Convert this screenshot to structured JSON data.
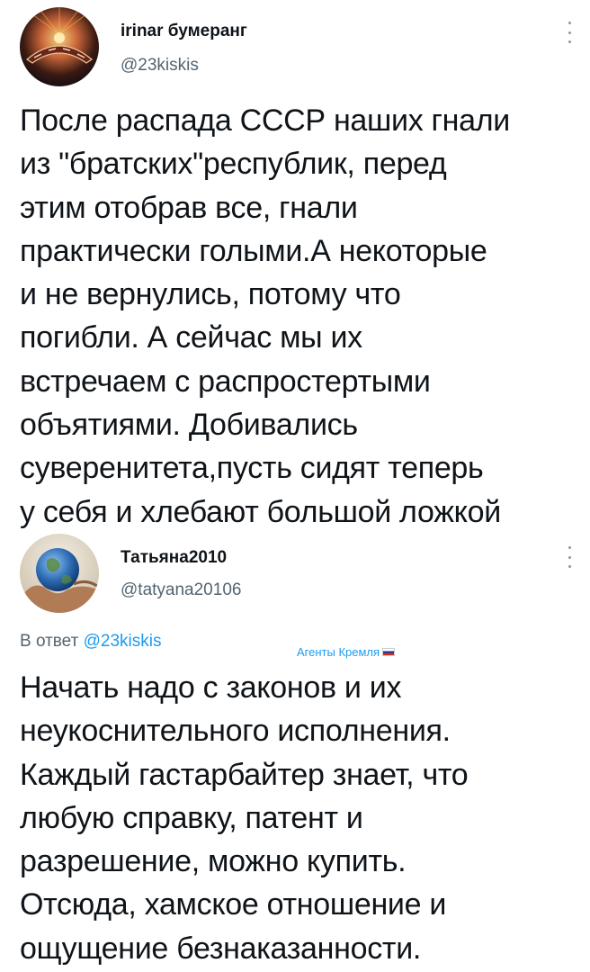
{
  "tweets": [
    {
      "author": {
        "display_name": "irinar бумеранг",
        "handle": "@23kiskis",
        "avatar_icon": "boomerang-avatar-icon"
      },
      "text": "После распада СССР наших гнали\nиз \"братских\"республик, перед\nэтим отобрав все, гнали\nпрактически голыми.А некоторые\nи не вернулись, потому что\nпогибли. А сейчас мы их\nвстречаем с распростертыми\nобъятиями. Добивались\nсуверенитета,пусть сидят теперь\nу себя и хлебают большой ложкой"
    },
    {
      "author": {
        "display_name": "Татьяна2010",
        "handle": "@tatyana20106",
        "avatar_icon": "earth-in-hands-avatar-icon"
      },
      "reply_prefix": "В ответ ",
      "reply_to": "@23kiskis",
      "text": "Начать надо с законов и их\nнеукоснительного исполнения.\nКаждый гастарбайтер знает, что\nлюбую справку, патент и\nразрешение, можно купить.\nОтсюда, хамское отношение и\nощущение безнаказанности."
    }
  ],
  "overlay": {
    "label": "Агенты Кремля",
    "flag_icon": "russian-flag-icon"
  },
  "colors": {
    "text": "#0f1419",
    "secondary": "#536471",
    "accent": "#1d9bf0"
  }
}
